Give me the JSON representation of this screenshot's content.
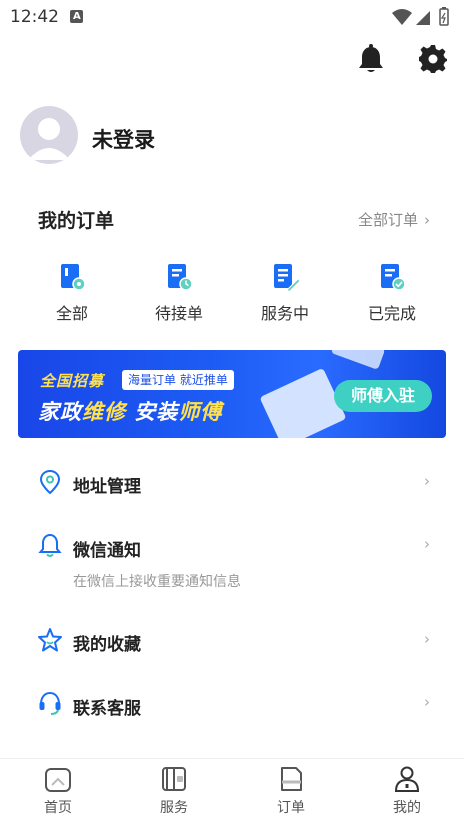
{
  "status_bar": {
    "time": "12:42",
    "notif_icon": "a-badge-icon"
  },
  "header": {
    "bell_icon": "bell-icon",
    "settings_icon": "gear-icon"
  },
  "profile": {
    "name": "未登录"
  },
  "orders": {
    "title": "我的订单",
    "all_label": "全部订单",
    "items": [
      {
        "label": "全部",
        "icon": "all-orders-icon"
      },
      {
        "label": "待接单",
        "icon": "pending-icon"
      },
      {
        "label": "服务中",
        "icon": "in-service-icon"
      },
      {
        "label": "已完成",
        "icon": "completed-icon"
      }
    ]
  },
  "banner": {
    "line1": "全国招募",
    "tag": "海量订单 就近推单",
    "line2_part1": "家政",
    "line2_part2": "维修",
    "line2_part3": " 安装",
    "line2_part4": "师傅",
    "button": "师傅入驻"
  },
  "menu": {
    "address": {
      "title": "地址管理"
    },
    "wechat": {
      "title": "微信通知",
      "sub": "在微信上接收重要通知信息"
    },
    "favorites": {
      "title": "我的收藏"
    },
    "service": {
      "title": "联系客服"
    }
  },
  "bottom_nav": {
    "items": [
      {
        "label": "首页"
      },
      {
        "label": "服务"
      },
      {
        "label": "订单"
      },
      {
        "label": "我的"
      }
    ]
  },
  "colors": {
    "accent": "#1a6ef5",
    "banner_blue": "#1d5cf4",
    "banner_yellow": "#ffe04d",
    "banner_btn": "#3fd0c4"
  }
}
